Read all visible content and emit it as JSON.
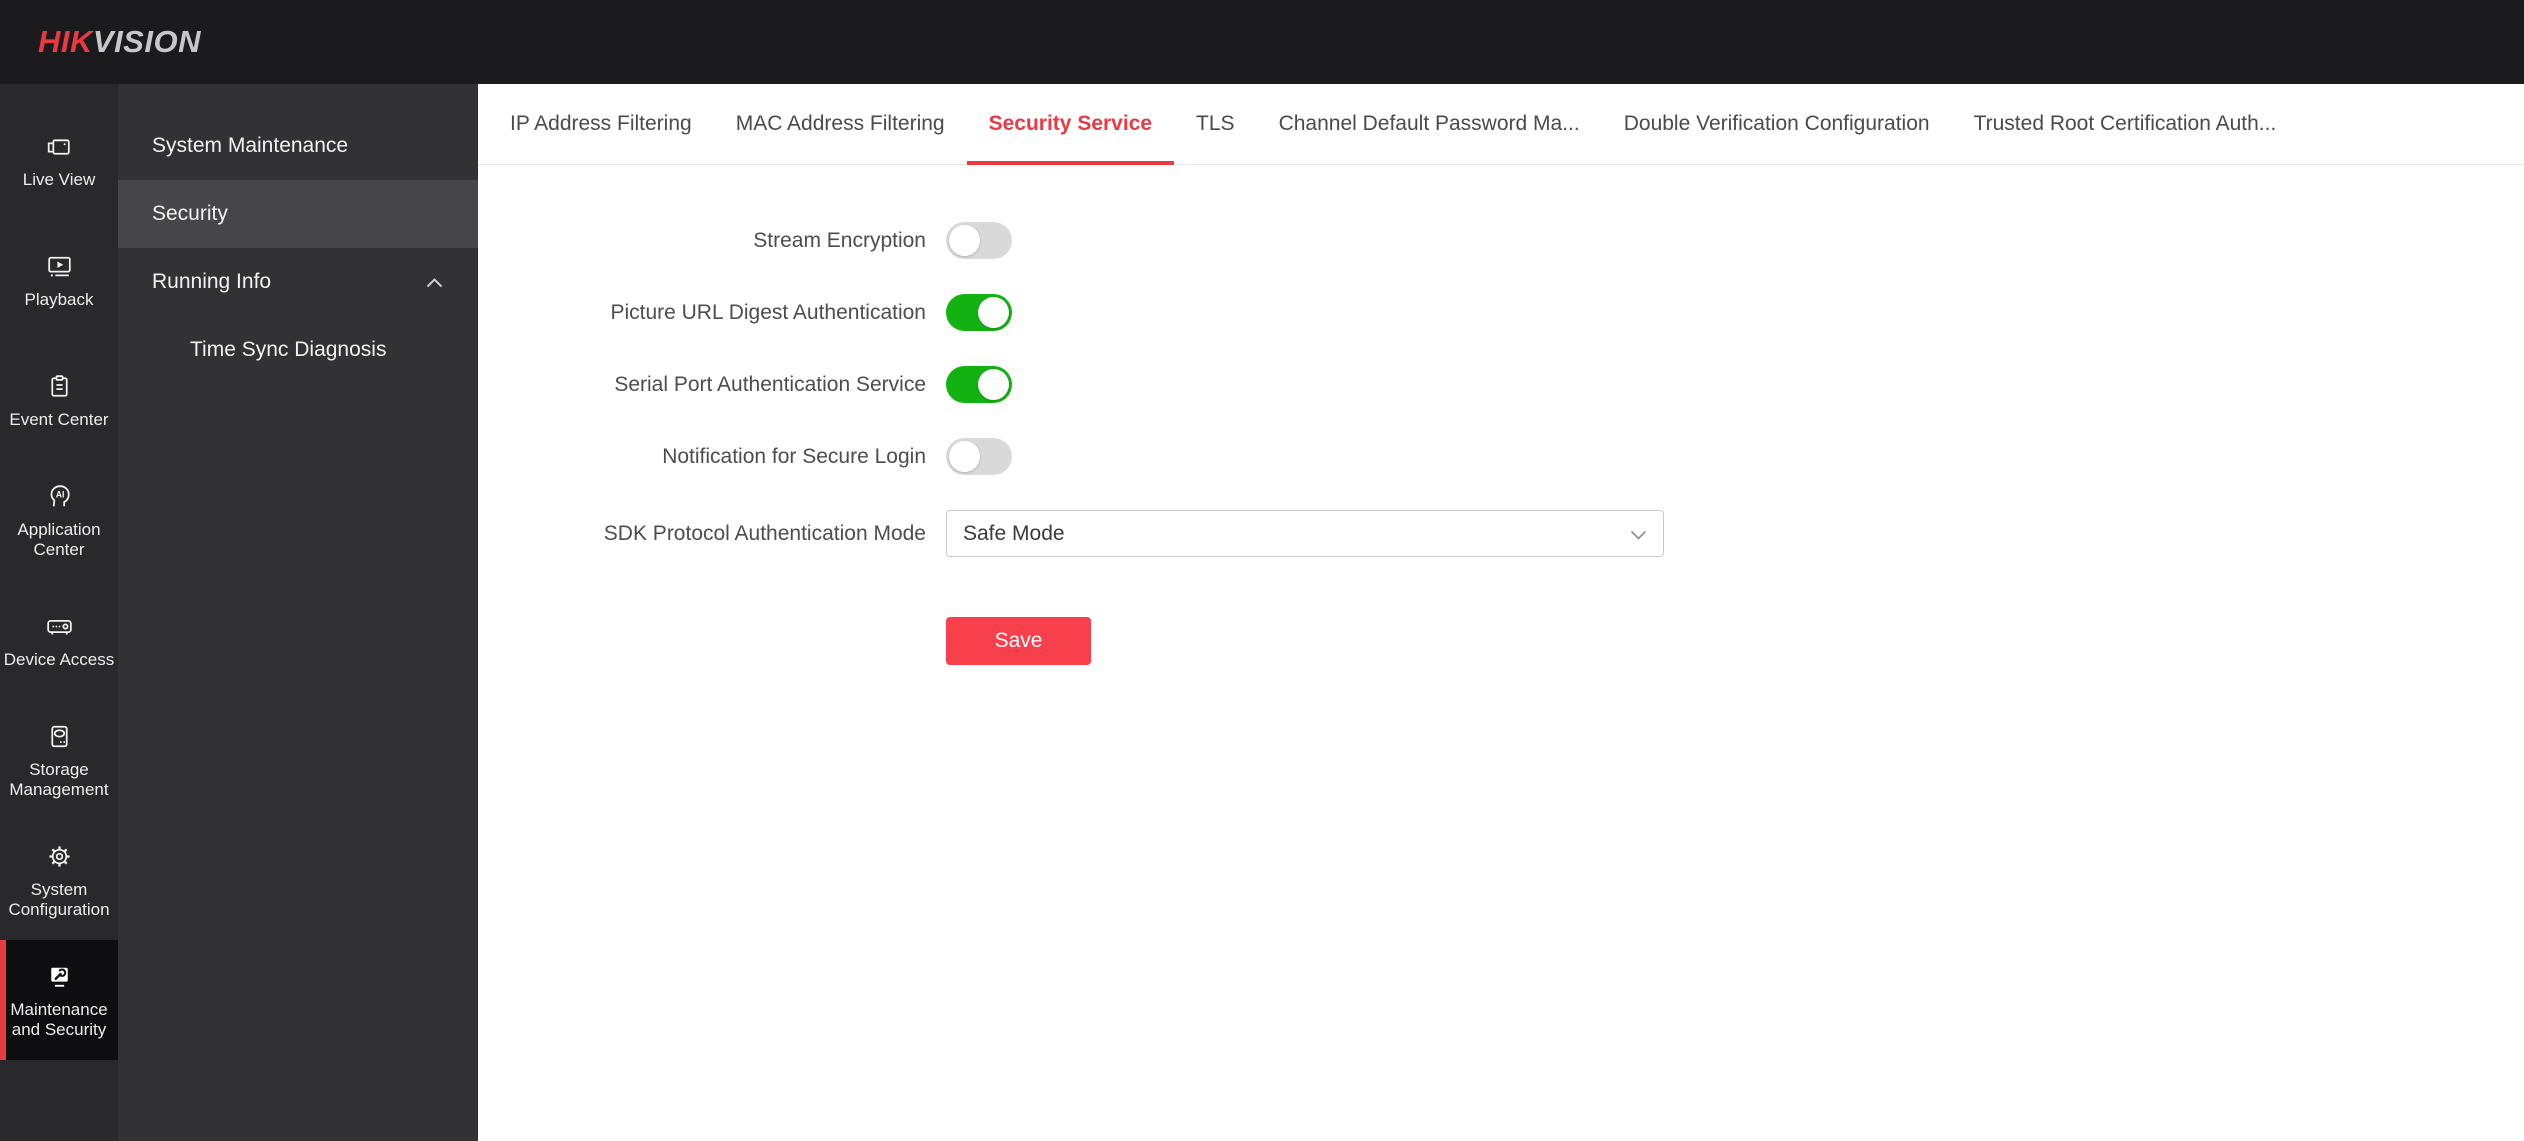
{
  "topbar": {
    "logo": {
      "hik": "HIK",
      "vision": "VISION"
    }
  },
  "rail": {
    "items": [
      {
        "label": "Live View",
        "icon": "live-view-icon",
        "active": false
      },
      {
        "label": "Playback",
        "icon": "playback-icon",
        "active": false
      },
      {
        "label": "Event Center",
        "icon": "event-center-icon",
        "active": false
      },
      {
        "label": "Application Center",
        "icon": "application-center-icon",
        "active": false
      },
      {
        "label": "Device Access",
        "icon": "device-access-icon",
        "active": false
      },
      {
        "label": "Storage Management",
        "icon": "storage-management-icon",
        "active": false
      },
      {
        "label": "System Configuration",
        "icon": "system-configuration-icon",
        "active": false
      },
      {
        "label": "Maintenance and Security",
        "icon": "maintenance-security-icon",
        "active": true
      }
    ]
  },
  "subnav": {
    "items": [
      {
        "label": "System Maintenance",
        "selected": false
      },
      {
        "label": "Security",
        "selected": true
      },
      {
        "label": "Running Info",
        "selected": false,
        "expanded": true
      },
      {
        "label": "Time Sync Diagnosis",
        "selected": false,
        "child": true
      }
    ]
  },
  "tabs": {
    "items": [
      {
        "label": "IP Address Filtering",
        "active": false
      },
      {
        "label": "MAC Address Filtering",
        "active": false
      },
      {
        "label": "Security Service",
        "active": true
      },
      {
        "label": "TLS",
        "active": false
      },
      {
        "label": "Channel Default Password Ma...",
        "active": false
      },
      {
        "label": "Double Verification Configuration",
        "active": false
      },
      {
        "label": "Trusted Root Certification Auth...",
        "active": false
      }
    ]
  },
  "form": {
    "rows": [
      {
        "label": "Stream Encryption",
        "type": "toggle",
        "value": false
      },
      {
        "label": "Picture URL Digest Authentication",
        "type": "toggle",
        "value": true
      },
      {
        "label": "Serial Port Authentication Service",
        "type": "toggle",
        "value": true
      },
      {
        "label": "Notification for Secure Login",
        "type": "toggle",
        "value": false
      },
      {
        "label": "SDK Protocol Authentication Mode",
        "type": "select",
        "value": "Safe Mode"
      }
    ],
    "save_label": "Save"
  },
  "colors": {
    "accent_red": "#e93a44",
    "button_red": "#f7404b",
    "toggle_on_green": "#12b212",
    "topbar_bg": "#1b1b1d",
    "rail_bg": "#29292b",
    "rail_active_bg": "#0e0e10",
    "subnav_bg": "#323234",
    "subnav_selected_bg": "#46464a"
  }
}
